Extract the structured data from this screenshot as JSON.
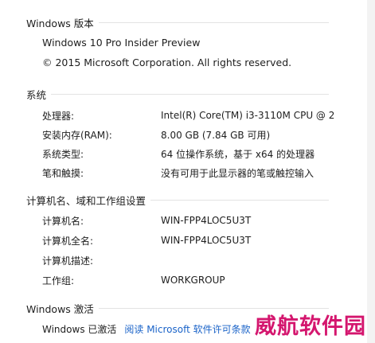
{
  "edition_section": {
    "header": "Windows 版本",
    "edition": "Windows 10 Pro Insider Preview",
    "copyright": "© 2015 Microsoft Corporation. All rights reserved."
  },
  "system_section": {
    "header": "系统",
    "rows": [
      {
        "label": "处理器:",
        "value": "Intel(R) Core(TM) i3-3110M CPU @ 2"
      },
      {
        "label": "安装内存(RAM):",
        "value": "8.00 GB (7.84 GB 可用)"
      },
      {
        "label": "系统类型:",
        "value": "64 位操作系统，基于 x64 的处理器"
      },
      {
        "label": "笔和触摸:",
        "value": "没有可用于此显示器的笔或触控输入"
      }
    ]
  },
  "computer_section": {
    "header": "计算机名、域和工作组设置",
    "rows": [
      {
        "label": "计算机名:",
        "value": "WIN-FPP4LOC5U3T"
      },
      {
        "label": "计算机全名:",
        "value": "WIN-FPP4LOC5U3T"
      },
      {
        "label": "计算机描述:",
        "value": ""
      },
      {
        "label": "工作组:",
        "value": "WORKGROUP"
      }
    ]
  },
  "activation_section": {
    "header": "Windows 激活",
    "status": "Windows 已激活",
    "license_link": "阅读 Microsoft 软件许可条款"
  },
  "watermark": "威航软件园",
  "colors": {
    "link": "#1a63c8",
    "watermark": "#d4166e"
  }
}
